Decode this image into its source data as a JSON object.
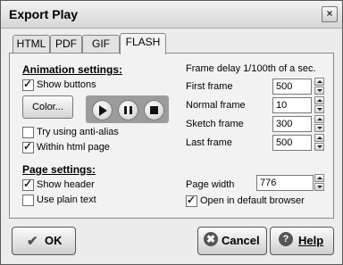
{
  "window": {
    "title": "Export Play",
    "close_glyph": "×"
  },
  "tabs": [
    "HTML",
    "PDF",
    "GIF",
    "FLASH"
  ],
  "animation": {
    "heading": "Animation settings:",
    "show_buttons": {
      "label": "Show buttons",
      "checked": true
    },
    "color_button": "Color...",
    "anti_alias": {
      "label": "Try using anti-alias",
      "checked": false
    },
    "within_html": {
      "label": "Within html page",
      "checked": true
    }
  },
  "frame": {
    "delay_label": "Frame delay 1/100th of a sec.",
    "rows": [
      {
        "label": "First frame",
        "value": "500"
      },
      {
        "label": "Normal frame",
        "value": "10"
      },
      {
        "label": "Sketch frame",
        "value": "300"
      },
      {
        "label": "Last frame",
        "value": "500"
      }
    ]
  },
  "page": {
    "heading": "Page settings:",
    "show_header": {
      "label": "Show header",
      "checked": true
    },
    "plain_text": {
      "label": "Use plain text",
      "checked": false
    },
    "width_label": "Page width",
    "width_value": "776",
    "open_browser": {
      "label": "Open in default browser",
      "checked": true
    }
  },
  "buttons": {
    "ok": "OK",
    "cancel": "Cancel",
    "help": "Help"
  },
  "icons": {
    "ok": "check-icon",
    "cancel": "cancel-x-icon",
    "help": "help-icon",
    "play": "play-icon",
    "pause": "pause-icon",
    "stop": "stop-icon"
  }
}
